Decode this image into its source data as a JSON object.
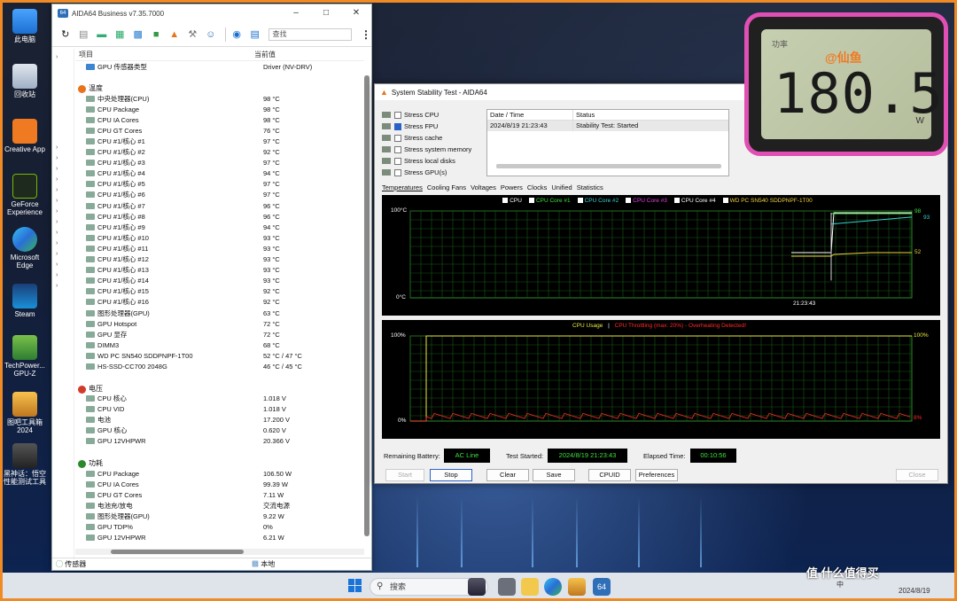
{
  "desktop": {
    "icons": [
      {
        "label": "此电脑"
      },
      {
        "label": "回收站"
      },
      {
        "label": "Creative App"
      },
      {
        "label": "GeForce Experience"
      },
      {
        "label": "Microsoft Edge"
      },
      {
        "label": "Steam"
      },
      {
        "label": "TechPower... GPU-Z"
      },
      {
        "label": "图吧工具箱 2024"
      },
      {
        "label": "黑神话：悟空 性能测试工具"
      }
    ]
  },
  "aida": {
    "title": "AIDA64 Business v7.35.7000",
    "badge": "64",
    "search_placeholder": "查找",
    "col_item": "项目",
    "col_value": "当前值",
    "sensor_type_label": "GPU 传感器类型",
    "sensor_type_value": "Driver  (NV-DRV)",
    "sections": [
      {
        "title": "温度",
        "rows": [
          {
            "name": "中央处理器(CPU)",
            "value": "98 °C"
          },
          {
            "name": "CPU Package",
            "value": "98 °C"
          },
          {
            "name": "CPU IA Cores",
            "value": "98 °C"
          },
          {
            "name": "CPU GT Cores",
            "value": "76 °C"
          },
          {
            "name": "CPU #1/核心 #1",
            "value": "97 °C"
          },
          {
            "name": "CPU #1/核心 #2",
            "value": "92 °C"
          },
          {
            "name": "CPU #1/核心 #3",
            "value": "97 °C"
          },
          {
            "name": "CPU #1/核心 #4",
            "value": "94 °C"
          },
          {
            "name": "CPU #1/核心 #5",
            "value": "97 °C"
          },
          {
            "name": "CPU #1/核心 #6",
            "value": "97 °C"
          },
          {
            "name": "CPU #1/核心 #7",
            "value": "96 °C"
          },
          {
            "name": "CPU #1/核心 #8",
            "value": "96 °C"
          },
          {
            "name": "CPU #1/核心 #9",
            "value": "94 °C"
          },
          {
            "name": "CPU #1/核心 #10",
            "value": "93 °C"
          },
          {
            "name": "CPU #1/核心 #11",
            "value": "93 °C"
          },
          {
            "name": "CPU #1/核心 #12",
            "value": "93 °C"
          },
          {
            "name": "CPU #1/核心 #13",
            "value": "93 °C"
          },
          {
            "name": "CPU #1/核心 #14",
            "value": "93 °C"
          },
          {
            "name": "CPU #1/核心 #15",
            "value": "92 °C"
          },
          {
            "name": "CPU #1/核心 #16",
            "value": "92 °C"
          },
          {
            "name": "图形处理器(GPU)",
            "value": "63 °C"
          },
          {
            "name": "GPU Hotspot",
            "value": "72 °C"
          },
          {
            "name": "GPU 显存",
            "value": "72 °C"
          },
          {
            "name": "DIMM3",
            "value": "68 °C"
          },
          {
            "name": "WD PC SN540 SDDPNPF-1T00",
            "value": "52 °C / 47 °C"
          },
          {
            "name": "HS-SSD-CC700 2048G",
            "value": "46 °C / 45 °C"
          }
        ]
      },
      {
        "title": "电压",
        "rows": [
          {
            "name": "CPU 核心",
            "value": "1.018 V"
          },
          {
            "name": "CPU VID",
            "value": "1.018 V"
          },
          {
            "name": "电池",
            "value": "17.200 V"
          },
          {
            "name": "GPU 核心",
            "value": "0.620 V"
          },
          {
            "name": "GPU 12VHPWR",
            "value": "20.366 V"
          }
        ]
      },
      {
        "title": "功耗",
        "rows": [
          {
            "name": "CPU Package",
            "value": "106.50 W"
          },
          {
            "name": "CPU IA Cores",
            "value": "99.39 W"
          },
          {
            "name": "CPU GT Cores",
            "value": "7.11 W"
          },
          {
            "name": "电池充/放电",
            "value": "交流电源"
          },
          {
            "name": "图形处理器(GPU)",
            "value": "9.22 W"
          },
          {
            "name": "GPU TDP%",
            "value": "0%"
          },
          {
            "name": "GPU 12VHPWR",
            "value": "6.21 W"
          }
        ]
      }
    ],
    "status_left": "传感器",
    "status_right": "本地"
  },
  "sst": {
    "title": "System Stability Test - AIDA64",
    "stress": [
      {
        "label": "Stress CPU",
        "checked": false
      },
      {
        "label": "Stress FPU",
        "checked": true
      },
      {
        "label": "Stress cache",
        "checked": false
      },
      {
        "label": "Stress system memory",
        "checked": false
      },
      {
        "label": "Stress local disks",
        "checked": false
      },
      {
        "label": "Stress GPU(s)",
        "checked": false
      }
    ],
    "log_headers": {
      "date": "Date / Time",
      "status": "Status"
    },
    "log_rows": [
      {
        "date": "2024/8/19 21:23:43",
        "status": "Stability Test: Started"
      }
    ],
    "tabs": [
      "Temperatures",
      "Cooling Fans",
      "Voltages",
      "Powers",
      "Clocks",
      "Unified",
      "Statistics"
    ],
    "temp_legend": [
      {
        "label": "CPU",
        "color": "#ffffff"
      },
      {
        "label": "CPU Core #1",
        "color": "#3ee03e"
      },
      {
        "label": "CPU Core #2",
        "color": "#39d0d0"
      },
      {
        "label": "CPU Core #3",
        "color": "#e040e0"
      },
      {
        "label": "CPU Core #4",
        "color": "#ffffff"
      },
      {
        "label": "WD PC SN540 SDDPNPF-1T00",
        "color": "#f0d040"
      }
    ],
    "temp_axis": {
      "top": "100°C",
      "bottom": "0°C",
      "time": "21:23:43"
    },
    "temp_end_labels": {
      "a": "98",
      "b": "93",
      "c": "52"
    },
    "usage_legend": {
      "a": "CPU Usage",
      "sep": "|",
      "b": "CPU Throttling (max: 20%) - Overheating Detected!"
    },
    "usage_axis": {
      "top_left": "100%",
      "bottom_left": "0%",
      "top_right": "100%",
      "bottom_right": "8%"
    },
    "info": {
      "battery_label": "Remaining Battery:",
      "battery_value": "AC Line",
      "started_label": "Test Started:",
      "started_value": "2024/8/19 21:23:43",
      "elapsed_label": "Elapsed Time:",
      "elapsed_value": "00:10:56"
    },
    "buttons": {
      "start": "Start",
      "stop": "Stop",
      "clear": "Clear",
      "save": "Save",
      "cpuid": "CPUID",
      "preferences": "Preferences",
      "close": "Close"
    },
    "chart_data": [
      {
        "type": "line",
        "title": "",
        "ylim": [
          0,
          100
        ],
        "series": [
          {
            "name": "CPU",
            "values": [
              52,
              52,
              52,
              98,
              98,
              98
            ]
          },
          {
            "name": "WD PC SN540 SDDPNPF-1T00",
            "values": [
              48,
              48,
              48,
              50,
              52,
              52
            ]
          }
        ]
      },
      {
        "type": "line",
        "title": "",
        "ylim": [
          0,
          100
        ],
        "series": [
          {
            "name": "CPU Usage",
            "values": [
              0,
              100,
              100,
              100
            ]
          },
          {
            "name": "CPU Throttling (max: 20%) - Overheating Detected!",
            "values": [
              0,
              5,
              6,
              8
            ]
          }
        ]
      }
    ]
  },
  "meter": {
    "label": "功率",
    "tag": "@仙鱼",
    "reading": "180.5",
    "unit": "W",
    "border_color": "#e04fb4"
  },
  "taskbar": {
    "search_placeholder": "搜索",
    "tray_lang": "中",
    "tray_date": "2024/8/19"
  },
  "watermark": "值 什么值得买"
}
